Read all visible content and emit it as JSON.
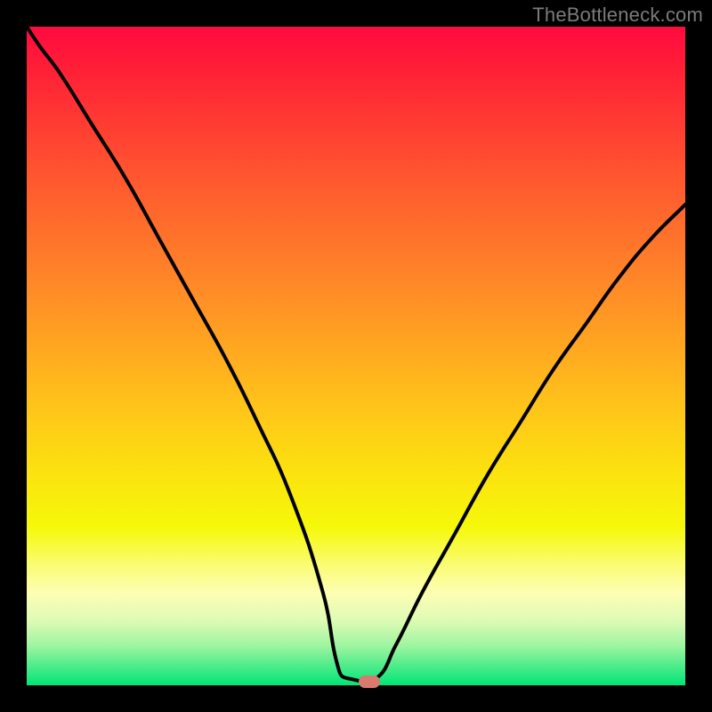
{
  "watermark": "TheBottleneck.com",
  "colors": {
    "frame": "#000000",
    "gradient_top": "#ff0a3f",
    "gradient_bottom": "#00e676",
    "curve": "#000000",
    "marker": "#d87a6f"
  },
  "chart_data": {
    "type": "line",
    "title": "",
    "xlabel": "",
    "ylabel": "",
    "xlim": [
      0,
      1
    ],
    "ylim": [
      0,
      1
    ],
    "annotations": [],
    "series": [
      {
        "name": "bottleneck-curve",
        "x": [
          0.0,
          0.02,
          0.05,
          0.1,
          0.15,
          0.2,
          0.25,
          0.3,
          0.35,
          0.4,
          0.45,
          0.475,
          0.49,
          0.53,
          0.56,
          0.6,
          0.65,
          0.7,
          0.75,
          0.8,
          0.85,
          0.9,
          0.95,
          1.0
        ],
        "y": [
          1.0,
          0.97,
          0.93,
          0.85,
          0.77,
          0.68,
          0.59,
          0.5,
          0.4,
          0.29,
          0.14,
          0.02,
          0.01,
          0.01,
          0.06,
          0.14,
          0.23,
          0.32,
          0.4,
          0.48,
          0.55,
          0.62,
          0.68,
          0.73
        ]
      }
    ],
    "marker": {
      "x": 0.52,
      "y": 0.006
    }
  }
}
